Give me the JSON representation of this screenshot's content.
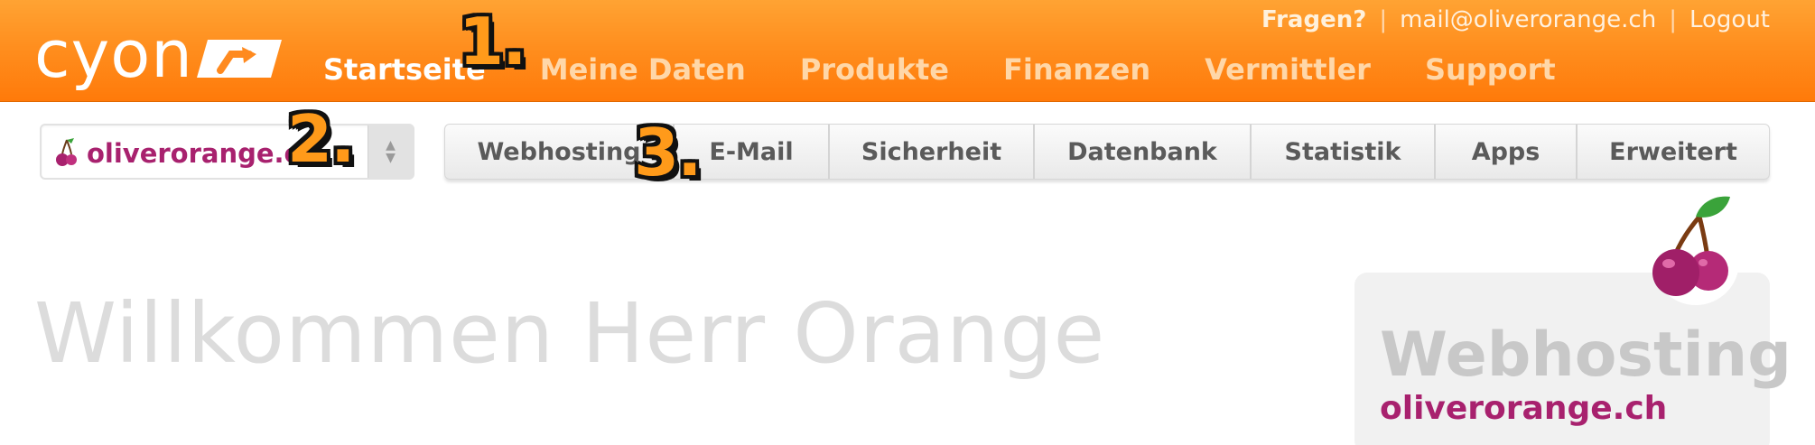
{
  "brand": {
    "logo_text": "cyon",
    "accent_color": "#ff8a1f",
    "domain_color": "#a8216e"
  },
  "top_links": {
    "questions": "Fragen?",
    "email": "mail@oliverorange.ch",
    "logout": "Logout"
  },
  "main_nav": {
    "items": [
      {
        "label": "Startseite",
        "active": true
      },
      {
        "label": "Meine Daten",
        "active": false
      },
      {
        "label": "Produkte",
        "active": false
      },
      {
        "label": "Finanzen",
        "active": false
      },
      {
        "label": "Vermittler",
        "active": false
      },
      {
        "label": "Support",
        "active": false
      }
    ]
  },
  "markers": [
    "1.",
    "2.",
    "3."
  ],
  "domain_select": {
    "value": "oliverorange.ch",
    "icon": "cherry-icon"
  },
  "sub_tabs": [
    {
      "label": "Webhosting"
    },
    {
      "label": "E-Mail"
    },
    {
      "label": "Sicherheit"
    },
    {
      "label": "Datenbank"
    },
    {
      "label": "Statistik"
    },
    {
      "label": "Apps"
    },
    {
      "label": "Erweitert"
    }
  ],
  "welcome": {
    "heading": "Willkommen Herr Orange"
  },
  "product_card": {
    "title": "Webhosting",
    "domain": "oliverorange.ch",
    "icon": "cherry-icon"
  }
}
